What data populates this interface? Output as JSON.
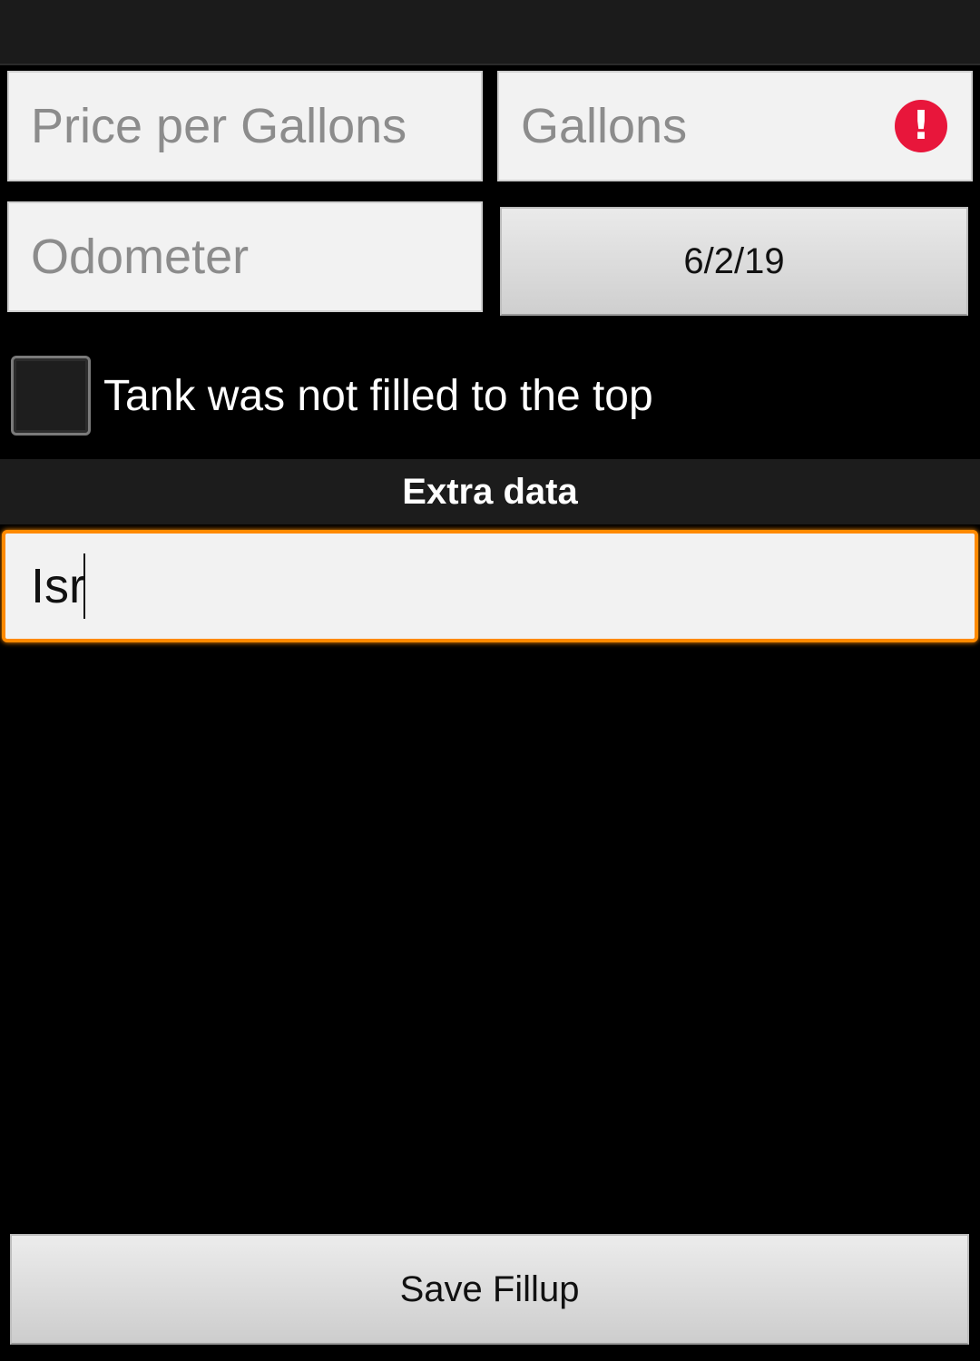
{
  "form": {
    "price_placeholder": "Price per Gallons",
    "gallons_placeholder": "Gallons",
    "gallons_error_icon": "error-icon",
    "odometer_placeholder": "Odometer",
    "date_value": "6/2/19",
    "partial_fill_label": "Tank was not filled to the top",
    "partial_fill_checked": false
  },
  "extra": {
    "header": "Extra data",
    "value": "Isr"
  },
  "actions": {
    "save_label": "Save Fillup"
  },
  "colors": {
    "accent": "#ff8a00",
    "error": "#e8163b",
    "background": "#000000"
  }
}
